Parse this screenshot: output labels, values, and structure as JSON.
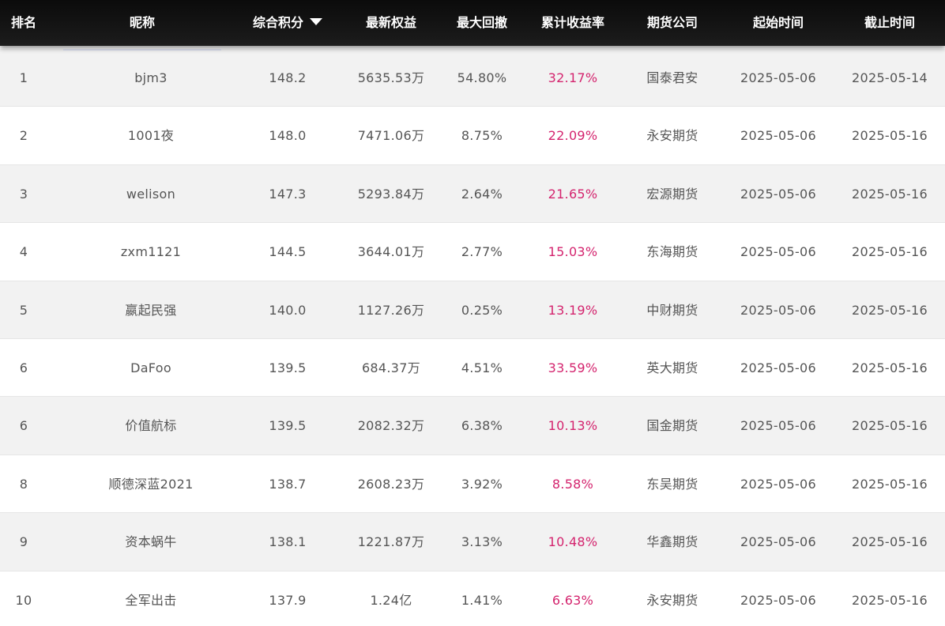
{
  "header": {
    "rank": "排名",
    "nickname": "昵称",
    "score": "综合积分",
    "equity": "最新权益",
    "drawdown": "最大回撤",
    "return": "累计收益率",
    "firm": "期货公司",
    "start": "起始时间",
    "end": "截止时间"
  },
  "colors": {
    "header_bg": "#111111",
    "return_text": "#d4246e",
    "row_alt": "#f2f2f2"
  },
  "rows": [
    {
      "rank": "1",
      "nickname": "bjm3",
      "score": "148.2",
      "equity": "5635.53万",
      "drawdown": "54.80%",
      "return": "32.17%",
      "firm": "国泰君安",
      "start": "2025-05-06",
      "end": "2025-05-14"
    },
    {
      "rank": "2",
      "nickname": "1001夜",
      "score": "148.0",
      "equity": "7471.06万",
      "drawdown": "8.75%",
      "return": "22.09%",
      "firm": "永安期货",
      "start": "2025-05-06",
      "end": "2025-05-16"
    },
    {
      "rank": "3",
      "nickname": "welison",
      "score": "147.3",
      "equity": "5293.84万",
      "drawdown": "2.64%",
      "return": "21.65%",
      "firm": "宏源期货",
      "start": "2025-05-06",
      "end": "2025-05-16"
    },
    {
      "rank": "4",
      "nickname": "zxm1121",
      "score": "144.5",
      "equity": "3644.01万",
      "drawdown": "2.77%",
      "return": "15.03%",
      "firm": "东海期货",
      "start": "2025-05-06",
      "end": "2025-05-16"
    },
    {
      "rank": "5",
      "nickname": "嬴起民强",
      "score": "140.0",
      "equity": "1127.26万",
      "drawdown": "0.25%",
      "return": "13.19%",
      "firm": "中财期货",
      "start": "2025-05-06",
      "end": "2025-05-16"
    },
    {
      "rank": "6",
      "nickname": "DaFoo",
      "score": "139.5",
      "equity": "684.37万",
      "drawdown": "4.51%",
      "return": "33.59%",
      "firm": "英大期货",
      "start": "2025-05-06",
      "end": "2025-05-16"
    },
    {
      "rank": "6",
      "nickname": "价值航标",
      "score": "139.5",
      "equity": "2082.32万",
      "drawdown": "6.38%",
      "return": "10.13%",
      "firm": "国金期货",
      "start": "2025-05-06",
      "end": "2025-05-16"
    },
    {
      "rank": "8",
      "nickname": "顺德深蓝2021",
      "score": "138.7",
      "equity": "2608.23万",
      "drawdown": "3.92%",
      "return": "8.58%",
      "firm": "东吴期货",
      "start": "2025-05-06",
      "end": "2025-05-16"
    },
    {
      "rank": "9",
      "nickname": "资本蜗牛",
      "score": "138.1",
      "equity": "1221.87万",
      "drawdown": "3.13%",
      "return": "10.48%",
      "firm": "华鑫期货",
      "start": "2025-05-06",
      "end": "2025-05-16"
    },
    {
      "rank": "10",
      "nickname": "全军出击",
      "score": "137.9",
      "equity": "1.24亿",
      "drawdown": "1.41%",
      "return": "6.63%",
      "firm": "永安期货",
      "start": "2025-05-06",
      "end": "2025-05-16"
    }
  ]
}
